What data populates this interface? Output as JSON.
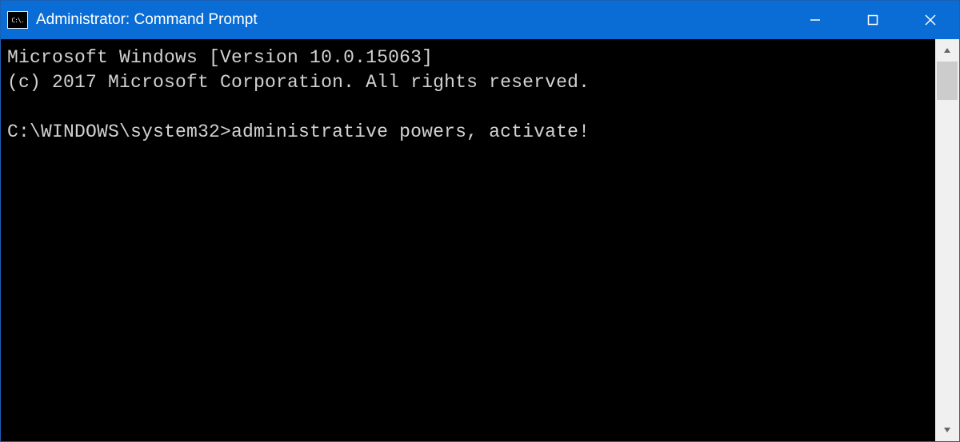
{
  "titlebar": {
    "icon_text": "C:\\.",
    "title": "Administrator: Command Prompt"
  },
  "terminal": {
    "line1": "Microsoft Windows [Version 10.0.15063]",
    "line2": "(c) 2017 Microsoft Corporation. All rights reserved.",
    "blank": " ",
    "prompt": "C:\\WINDOWS\\system32>",
    "command": "administrative powers, activate!"
  }
}
